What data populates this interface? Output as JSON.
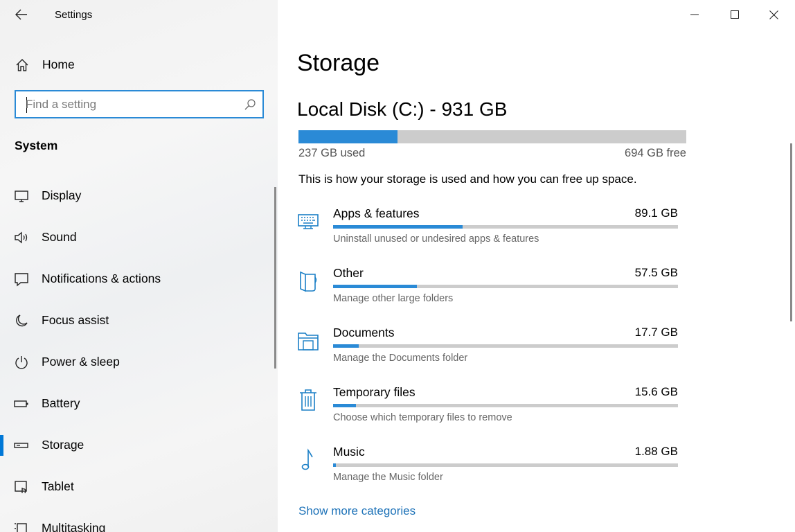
{
  "window": {
    "title": "Settings"
  },
  "sidebar": {
    "home_label": "Home",
    "search": {
      "placeholder": "Find a setting"
    },
    "section": "System",
    "items": [
      {
        "label": "Display",
        "icon": "monitor-icon"
      },
      {
        "label": "Sound",
        "icon": "speaker-icon"
      },
      {
        "label": "Notifications & actions",
        "icon": "notification-icon"
      },
      {
        "label": "Focus assist",
        "icon": "moon-icon"
      },
      {
        "label": "Power & sleep",
        "icon": "power-icon"
      },
      {
        "label": "Battery",
        "icon": "battery-icon"
      },
      {
        "label": "Storage",
        "icon": "storage-icon",
        "selected": true
      },
      {
        "label": "Tablet",
        "icon": "tablet-icon"
      },
      {
        "label": "Multitasking",
        "icon": "multitasking-icon"
      }
    ]
  },
  "main": {
    "title": "Storage",
    "disk": {
      "name": "Local Disk (C:) - 931 GB",
      "used_label": "237 GB used",
      "free_label": "694 GB free",
      "used_fraction": 0.255
    },
    "description": "This is how your storage is used and how you can free up space.",
    "categories": [
      {
        "name": "Apps & features",
        "size": "89.1 GB",
        "sub": "Uninstall unused or undesired apps & features",
        "fraction": 0.376,
        "icon": "keyboard-icon"
      },
      {
        "name": "Other",
        "size": "57.5 GB",
        "sub": "Manage other large folders",
        "fraction": 0.243,
        "icon": "folder-other-icon"
      },
      {
        "name": "Documents",
        "size": "17.7 GB",
        "sub": "Manage the Documents folder",
        "fraction": 0.075,
        "icon": "documents-folder-icon"
      },
      {
        "name": "Temporary files",
        "size": "15.6 GB",
        "sub": "Choose which temporary files to remove",
        "fraction": 0.066,
        "icon": "trash-icon"
      },
      {
        "name": "Music",
        "size": "1.88 GB",
        "sub": "Manage the Music folder",
        "fraction": 0.008,
        "icon": "music-note-icon"
      }
    ],
    "show_more": "Show more categories"
  },
  "colors": {
    "accent": "#0078d7",
    "bar_fill": "#2a8ad6",
    "bar_track": "#cccccc",
    "link": "#1d72b8"
  }
}
